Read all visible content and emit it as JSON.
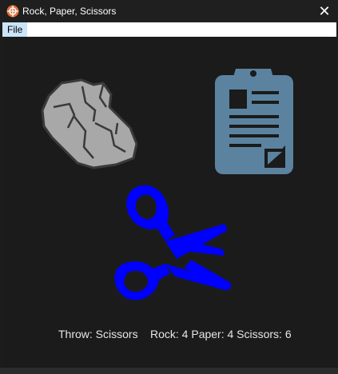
{
  "window": {
    "title": "Rock, Paper, Scissors",
    "close_label": "✕"
  },
  "menu": {
    "items": [
      "File"
    ]
  },
  "choices": {
    "rock": "rock-icon",
    "paper": "paper-icon",
    "scissors": "scissors-icon"
  },
  "status": {
    "throw": "Throw: Scissors",
    "scores": "Rock: 4 Paper: 4 Scissors: 6"
  },
  "colors": {
    "rock": "#a6a6a6",
    "paper": "#5b83a0",
    "scissors": "#0000ff",
    "background": "#1b1b1b"
  }
}
